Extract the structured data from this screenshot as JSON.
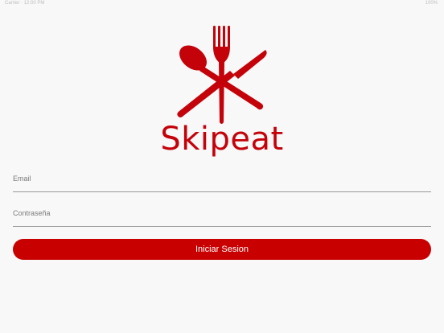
{
  "status_bar": {
    "left": "Carrier  ·  12:00 PM",
    "right": "100%"
  },
  "brand": {
    "name": "Skipeat",
    "color": "#c4020a"
  },
  "form": {
    "email_placeholder": "Email",
    "password_placeholder": "Contraseña",
    "login_label": "Iniciar Sesion"
  },
  "colors": {
    "accent": "#c80000",
    "background": "#f8f8f8",
    "underline": "#9a9a9a"
  },
  "icons": {
    "logo": "spoon-fork-knife-icon"
  }
}
